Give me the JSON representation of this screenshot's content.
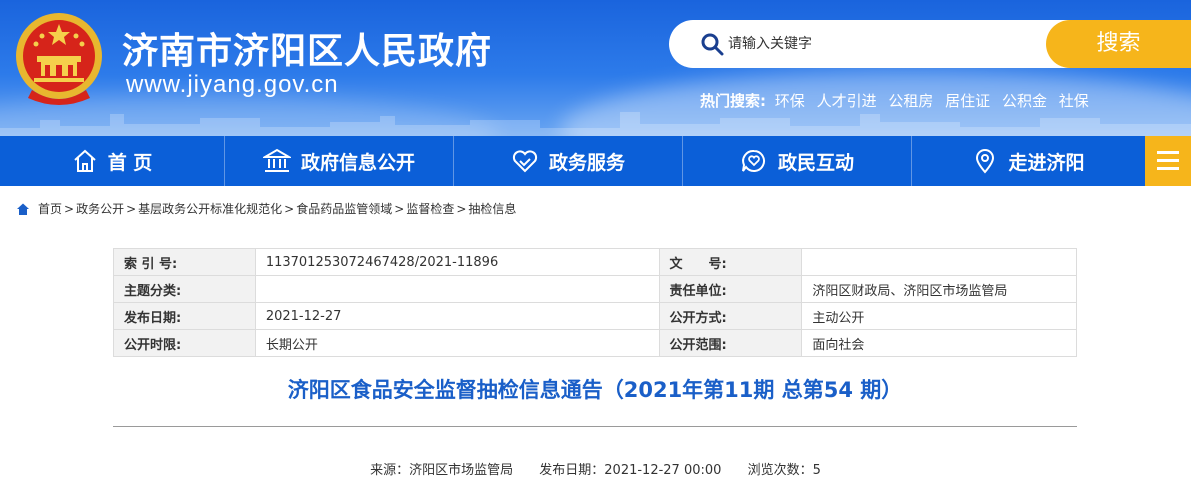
{
  "header": {
    "site_title": "济南市济阳区人民政府",
    "site_url": "www.jiyang.gov.cn",
    "search": {
      "placeholder": "请输入关键字",
      "button_label": "搜索"
    },
    "hot_search": {
      "label": "热门搜索:",
      "items": [
        "环保",
        "人才引进",
        "公租房",
        "居住证",
        "公积金",
        "社保"
      ]
    }
  },
  "nav": {
    "items": [
      {
        "label": "首 页",
        "icon": "home-icon"
      },
      {
        "label": "政府信息公开",
        "icon": "government-building-icon"
      },
      {
        "label": "政务服务",
        "icon": "handshake-icon"
      },
      {
        "label": "政民互动",
        "icon": "chat-heart-icon"
      },
      {
        "label": "走进济阳",
        "icon": "map-pin-icon"
      }
    ],
    "menu_icon": "hamburger-menu-icon"
  },
  "breadcrumb": {
    "icon": "home-icon",
    "items": [
      "首页",
      "政务公开",
      "基层政务公开标准化规范化",
      "食品药品监管领域",
      "监督检查",
      "抽检信息"
    ],
    "separator": ">"
  },
  "meta_table": {
    "rows": [
      {
        "k1": "索 引 号:",
        "v1": "113701253072467428/2021-11896",
        "k2": "文　　号:",
        "v2": ""
      },
      {
        "k1": "主题分类:",
        "v1": "",
        "k2": "责任单位:",
        "v2": "济阳区财政局、济阳区市场监管局"
      },
      {
        "k1": "发布日期:",
        "v1": "2021-12-27",
        "k2": "公开方式:",
        "v2": "主动公开"
      },
      {
        "k1": "公开时限:",
        "v1": "长期公开",
        "k2": "公开范围:",
        "v2": "面向社会"
      }
    ]
  },
  "article": {
    "title": "济阳区食品安全监督抽检信息通告（2021年第11期 总第54 期）",
    "source": "来源：济阳区市场监管局",
    "publish_time": "发布日期：2021-12-27 00:00",
    "views": "浏览次数：5"
  },
  "colors": {
    "header_blue": "#1a64dd",
    "nav_blue": "#0b5fd8",
    "accent_orange": "#f6b51b",
    "title_blue": "#1a5fc8"
  }
}
